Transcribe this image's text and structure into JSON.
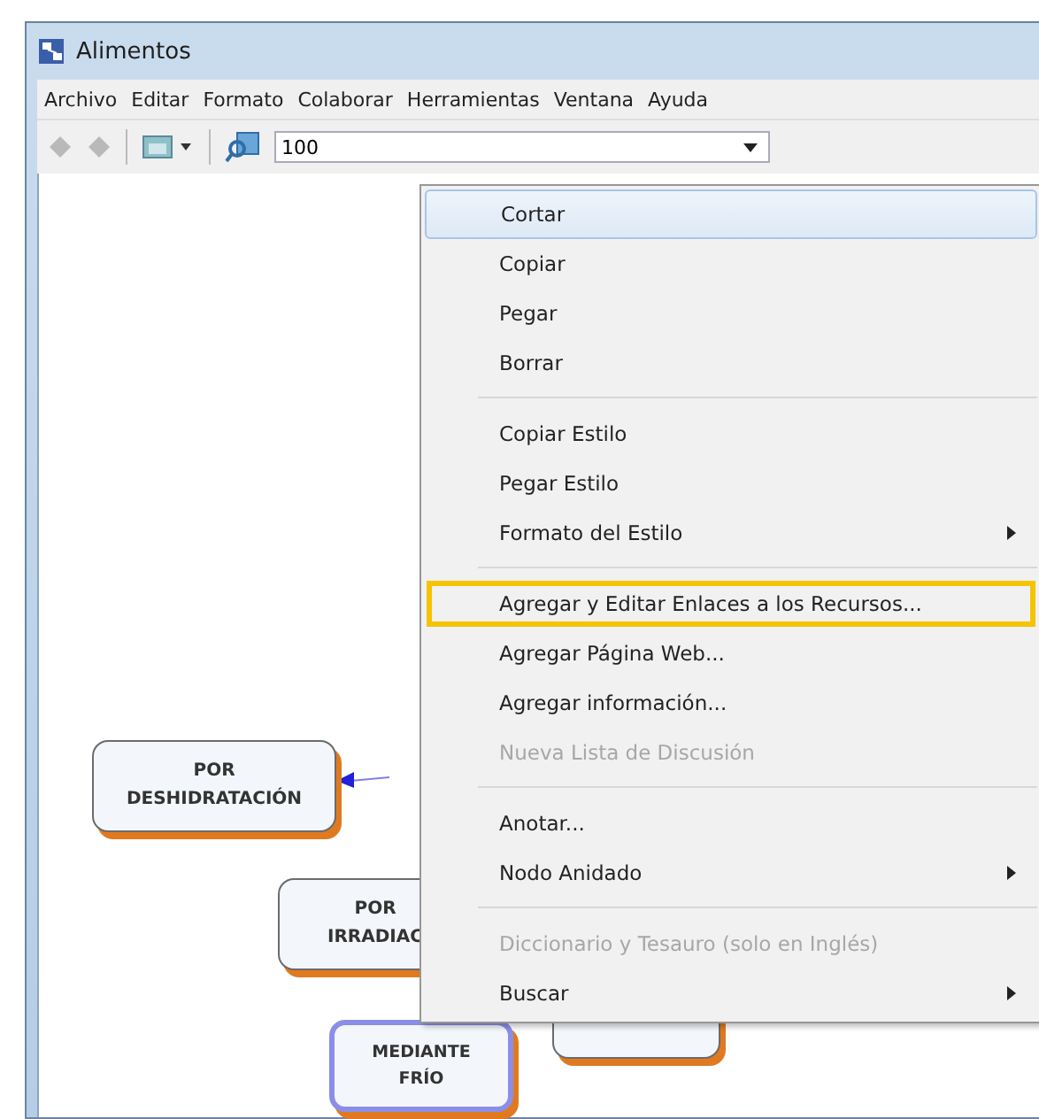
{
  "window": {
    "title": "Alimentos"
  },
  "menu_bar": [
    "Archivo",
    "Editar",
    "Formato",
    "Colaborar",
    "Herramientas",
    "Ventana",
    "Ayuda"
  ],
  "toolbar": {
    "zoom_value": "100"
  },
  "nodes": [
    {
      "lines": [
        "POR",
        "DESHIDRATACIÓN"
      ],
      "selected": false
    },
    {
      "lines": [
        "POR",
        "IRRADIAC"
      ],
      "selected": false
    },
    {
      "lines": [
        "MEDIANTE",
        "FRÍO"
      ],
      "selected": true
    },
    {
      "selected": false
    }
  ],
  "context_menu": [
    {
      "kind": "item",
      "label": "Cortar",
      "hover": true,
      "disabled": false,
      "submenu": false,
      "outlined": false
    },
    {
      "kind": "item",
      "label": "Copiar",
      "hover": false,
      "disabled": false,
      "submenu": false,
      "outlined": false
    },
    {
      "kind": "item",
      "label": "Pegar",
      "hover": false,
      "disabled": false,
      "submenu": false,
      "outlined": false
    },
    {
      "kind": "item",
      "label": "Borrar",
      "hover": false,
      "disabled": false,
      "submenu": false,
      "outlined": false
    },
    {
      "kind": "separator"
    },
    {
      "kind": "item",
      "label": "Copiar Estilo",
      "hover": false,
      "disabled": false,
      "submenu": false,
      "outlined": false
    },
    {
      "kind": "item",
      "label": "Pegar Estilo",
      "hover": false,
      "disabled": false,
      "submenu": false,
      "outlined": false
    },
    {
      "kind": "item",
      "label": "Formato del Estilo",
      "hover": false,
      "disabled": false,
      "submenu": true,
      "outlined": false
    },
    {
      "kind": "separator"
    },
    {
      "kind": "item",
      "label": "Agregar y Editar Enlaces a los Recursos...",
      "hover": false,
      "disabled": false,
      "submenu": false,
      "outlined": true
    },
    {
      "kind": "item",
      "label": "Agregar Página Web...",
      "hover": false,
      "disabled": false,
      "submenu": false,
      "outlined": false
    },
    {
      "kind": "item",
      "label": "Agregar información...",
      "hover": false,
      "disabled": false,
      "submenu": false,
      "outlined": false
    },
    {
      "kind": "item",
      "label": "Nueva Lista de Discusión",
      "hover": false,
      "disabled": true,
      "submenu": false,
      "outlined": false
    },
    {
      "kind": "separator"
    },
    {
      "kind": "item",
      "label": "Anotar...",
      "hover": false,
      "disabled": false,
      "submenu": false,
      "outlined": false
    },
    {
      "kind": "item",
      "label": "Nodo Anidado",
      "hover": false,
      "disabled": false,
      "submenu": true,
      "outlined": false
    },
    {
      "kind": "separator"
    },
    {
      "kind": "item",
      "label": "Diccionario y Tesauro (solo en Inglés)",
      "hover": false,
      "disabled": true,
      "submenu": false,
      "outlined": false
    },
    {
      "kind": "item",
      "label": "Buscar",
      "hover": false,
      "disabled": false,
      "submenu": true,
      "outlined": false
    }
  ]
}
